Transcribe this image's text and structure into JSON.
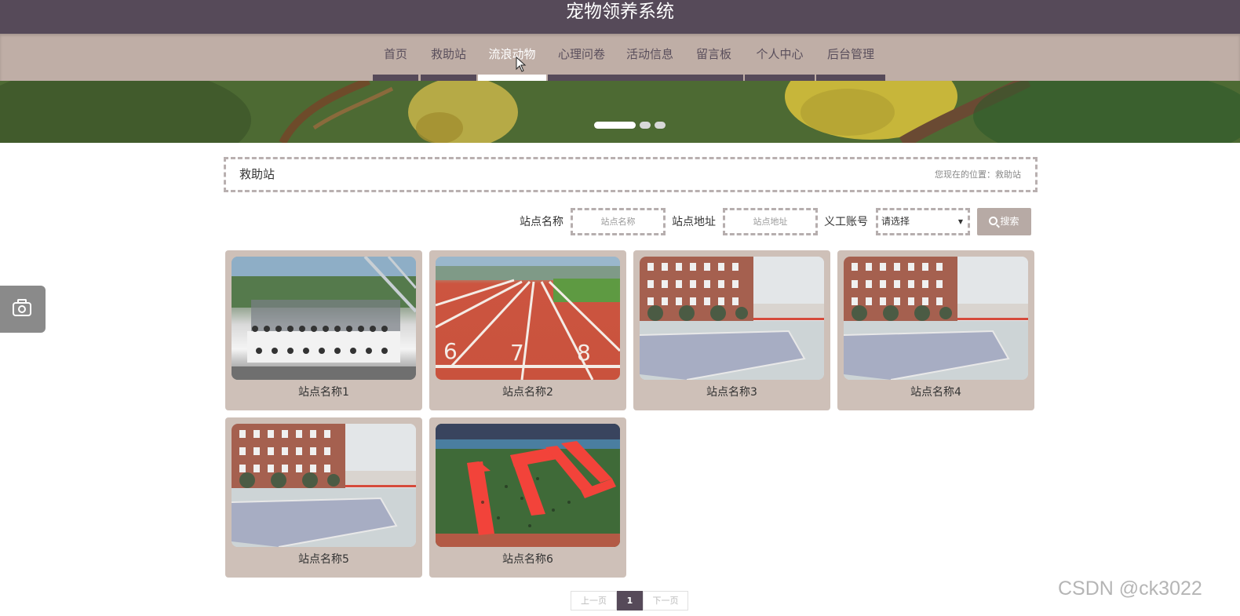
{
  "header": {
    "title": "宠物领养系统"
  },
  "nav": {
    "items": [
      {
        "label": "首页"
      },
      {
        "label": "救助站"
      },
      {
        "label": "流浪动物",
        "active": true
      },
      {
        "label": "心理问卷"
      },
      {
        "label": "活动信息"
      },
      {
        "label": "留言板"
      },
      {
        "label": "个人中心"
      },
      {
        "label": "后台管理"
      }
    ]
  },
  "banner": {
    "active_slide": 1,
    "slide_count": 3
  },
  "breadcrumb": {
    "title": "救助站",
    "location": "您现在的位置：救助站"
  },
  "filters": {
    "station_name_label": "站点名称",
    "station_name_placeholder": "站点名称",
    "station_address_label": "站点地址",
    "station_address_placeholder": "站点地址",
    "volunteer_label": "义工账号",
    "volunteer_select_value": "请选择",
    "search_label": "搜索"
  },
  "stations": [
    {
      "name": "站点名称1",
      "photo": "group-photo"
    },
    {
      "name": "站点名称2",
      "photo": "running-track"
    },
    {
      "name": "站点名称3",
      "photo": "school-building"
    },
    {
      "name": "站点名称4",
      "photo": "school-building"
    },
    {
      "name": "站点名称5",
      "photo": "school-building"
    },
    {
      "name": "站点名称6",
      "photo": "aerial-field"
    }
  ],
  "pagination": {
    "prev": "上一页",
    "current": "1",
    "next": "下一页"
  },
  "watermark": "CSDN @ck3022",
  "colors": {
    "topbar": "#564a59",
    "navbar": "#bfaea6",
    "card": "#cec0b8",
    "accent": "#564a59"
  }
}
